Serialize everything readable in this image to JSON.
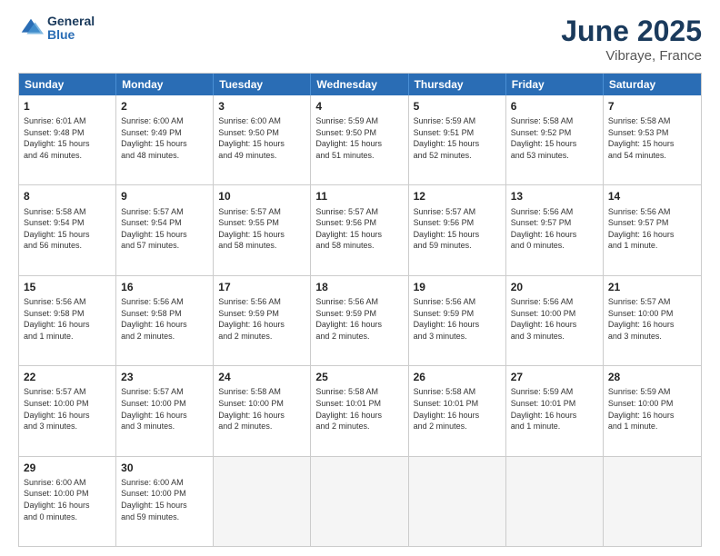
{
  "header": {
    "logo_general": "General",
    "logo_blue": "Blue",
    "month": "June 2025",
    "location": "Vibraye, France"
  },
  "days_of_week": [
    "Sunday",
    "Monday",
    "Tuesday",
    "Wednesday",
    "Thursday",
    "Friday",
    "Saturday"
  ],
  "weeks": [
    [
      {
        "day": "1",
        "lines": [
          "Sunrise: 6:01 AM",
          "Sunset: 9:48 PM",
          "Daylight: 15 hours",
          "and 46 minutes."
        ]
      },
      {
        "day": "2",
        "lines": [
          "Sunrise: 6:00 AM",
          "Sunset: 9:49 PM",
          "Daylight: 15 hours",
          "and 48 minutes."
        ]
      },
      {
        "day": "3",
        "lines": [
          "Sunrise: 6:00 AM",
          "Sunset: 9:50 PM",
          "Daylight: 15 hours",
          "and 49 minutes."
        ]
      },
      {
        "day": "4",
        "lines": [
          "Sunrise: 5:59 AM",
          "Sunset: 9:50 PM",
          "Daylight: 15 hours",
          "and 51 minutes."
        ]
      },
      {
        "day": "5",
        "lines": [
          "Sunrise: 5:59 AM",
          "Sunset: 9:51 PM",
          "Daylight: 15 hours",
          "and 52 minutes."
        ]
      },
      {
        "day": "6",
        "lines": [
          "Sunrise: 5:58 AM",
          "Sunset: 9:52 PM",
          "Daylight: 15 hours",
          "and 53 minutes."
        ]
      },
      {
        "day": "7",
        "lines": [
          "Sunrise: 5:58 AM",
          "Sunset: 9:53 PM",
          "Daylight: 15 hours",
          "and 54 minutes."
        ]
      }
    ],
    [
      {
        "day": "8",
        "lines": [
          "Sunrise: 5:58 AM",
          "Sunset: 9:54 PM",
          "Daylight: 15 hours",
          "and 56 minutes."
        ]
      },
      {
        "day": "9",
        "lines": [
          "Sunrise: 5:57 AM",
          "Sunset: 9:54 PM",
          "Daylight: 15 hours",
          "and 57 minutes."
        ]
      },
      {
        "day": "10",
        "lines": [
          "Sunrise: 5:57 AM",
          "Sunset: 9:55 PM",
          "Daylight: 15 hours",
          "and 58 minutes."
        ]
      },
      {
        "day": "11",
        "lines": [
          "Sunrise: 5:57 AM",
          "Sunset: 9:56 PM",
          "Daylight: 15 hours",
          "and 58 minutes."
        ]
      },
      {
        "day": "12",
        "lines": [
          "Sunrise: 5:57 AM",
          "Sunset: 9:56 PM",
          "Daylight: 15 hours",
          "and 59 minutes."
        ]
      },
      {
        "day": "13",
        "lines": [
          "Sunrise: 5:56 AM",
          "Sunset: 9:57 PM",
          "Daylight: 16 hours",
          "and 0 minutes."
        ]
      },
      {
        "day": "14",
        "lines": [
          "Sunrise: 5:56 AM",
          "Sunset: 9:57 PM",
          "Daylight: 16 hours",
          "and 1 minute."
        ]
      }
    ],
    [
      {
        "day": "15",
        "lines": [
          "Sunrise: 5:56 AM",
          "Sunset: 9:58 PM",
          "Daylight: 16 hours",
          "and 1 minute."
        ]
      },
      {
        "day": "16",
        "lines": [
          "Sunrise: 5:56 AM",
          "Sunset: 9:58 PM",
          "Daylight: 16 hours",
          "and 2 minutes."
        ]
      },
      {
        "day": "17",
        "lines": [
          "Sunrise: 5:56 AM",
          "Sunset: 9:59 PM",
          "Daylight: 16 hours",
          "and 2 minutes."
        ]
      },
      {
        "day": "18",
        "lines": [
          "Sunrise: 5:56 AM",
          "Sunset: 9:59 PM",
          "Daylight: 16 hours",
          "and 2 minutes."
        ]
      },
      {
        "day": "19",
        "lines": [
          "Sunrise: 5:56 AM",
          "Sunset: 9:59 PM",
          "Daylight: 16 hours",
          "and 3 minutes."
        ]
      },
      {
        "day": "20",
        "lines": [
          "Sunrise: 5:56 AM",
          "Sunset: 10:00 PM",
          "Daylight: 16 hours",
          "and 3 minutes."
        ]
      },
      {
        "day": "21",
        "lines": [
          "Sunrise: 5:57 AM",
          "Sunset: 10:00 PM",
          "Daylight: 16 hours",
          "and 3 minutes."
        ]
      }
    ],
    [
      {
        "day": "22",
        "lines": [
          "Sunrise: 5:57 AM",
          "Sunset: 10:00 PM",
          "Daylight: 16 hours",
          "and 3 minutes."
        ]
      },
      {
        "day": "23",
        "lines": [
          "Sunrise: 5:57 AM",
          "Sunset: 10:00 PM",
          "Daylight: 16 hours",
          "and 3 minutes."
        ]
      },
      {
        "day": "24",
        "lines": [
          "Sunrise: 5:58 AM",
          "Sunset: 10:00 PM",
          "Daylight: 16 hours",
          "and 2 minutes."
        ]
      },
      {
        "day": "25",
        "lines": [
          "Sunrise: 5:58 AM",
          "Sunset: 10:01 PM",
          "Daylight: 16 hours",
          "and 2 minutes."
        ]
      },
      {
        "day": "26",
        "lines": [
          "Sunrise: 5:58 AM",
          "Sunset: 10:01 PM",
          "Daylight: 16 hours",
          "and 2 minutes."
        ]
      },
      {
        "day": "27",
        "lines": [
          "Sunrise: 5:59 AM",
          "Sunset: 10:01 PM",
          "Daylight: 16 hours",
          "and 1 minute."
        ]
      },
      {
        "day": "28",
        "lines": [
          "Sunrise: 5:59 AM",
          "Sunset: 10:00 PM",
          "Daylight: 16 hours",
          "and 1 minute."
        ]
      }
    ],
    [
      {
        "day": "29",
        "lines": [
          "Sunrise: 6:00 AM",
          "Sunset: 10:00 PM",
          "Daylight: 16 hours",
          "and 0 minutes."
        ]
      },
      {
        "day": "30",
        "lines": [
          "Sunrise: 6:00 AM",
          "Sunset: 10:00 PM",
          "Daylight: 15 hours",
          "and 59 minutes."
        ]
      },
      {
        "day": "",
        "lines": []
      },
      {
        "day": "",
        "lines": []
      },
      {
        "day": "",
        "lines": []
      },
      {
        "day": "",
        "lines": []
      },
      {
        "day": "",
        "lines": []
      }
    ]
  ]
}
